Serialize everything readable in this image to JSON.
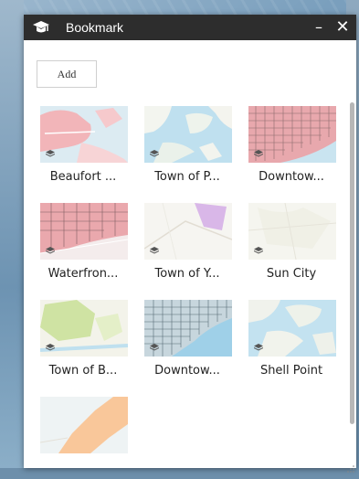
{
  "window": {
    "title": "Bookmark",
    "minimize_symbol": "–",
    "close_symbol": "✕",
    "icon": "graduation-cap-icon"
  },
  "toolbar": {
    "add_label": "Add"
  },
  "bookmarks": [
    {
      "label": "Beaufort ...",
      "thumb": "pink-parcels-map"
    },
    {
      "label": "Town of P...",
      "thumb": "water-islands-map"
    },
    {
      "label": "Downtow...",
      "thumb": "dense-grid-pink-map"
    },
    {
      "label": "Waterfron...",
      "thumb": "waterfront-parcels-map"
    },
    {
      "label": "Town of Y...",
      "thumb": "purple-town-map"
    },
    {
      "label": "Sun City",
      "thumb": "pale-streets-map"
    },
    {
      "label": "Town of B...",
      "thumb": "green-town-map"
    },
    {
      "label": "Downtow...",
      "thumb": "blue-grid-map"
    },
    {
      "label": "Shell Point",
      "thumb": "marsh-map"
    },
    {
      "label": "",
      "thumb": "orange-region-map"
    }
  ],
  "colors": {
    "titlebar": "#2d2d2d",
    "panel": "#ffffff",
    "water": "#bfe0ef",
    "pink": "#f2b5b9",
    "orange": "#f9c79a",
    "green": "#cfe3a3",
    "purple": "#d9b7e8"
  }
}
